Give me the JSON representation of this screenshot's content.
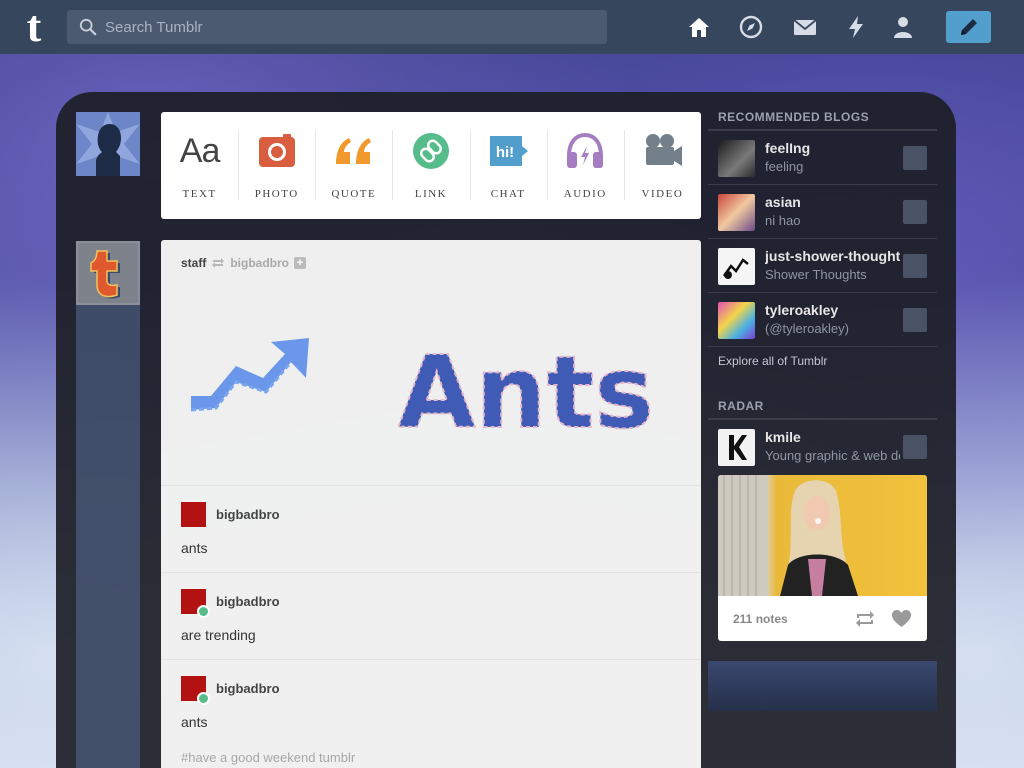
{
  "search": {
    "placeholder": "Search Tumblr"
  },
  "nav": {
    "icons": [
      "home-icon",
      "compass-icon",
      "mail-icon",
      "lightning-icon",
      "person-icon"
    ],
    "compose_icon": "pencil-icon",
    "accent": "#529ecc",
    "bar_color": "#36465d"
  },
  "post_types": [
    {
      "label": "TEXT",
      "icon": "text-icon",
      "color": "#444444"
    },
    {
      "label": "PHOTO",
      "icon": "camera-icon",
      "color": "#d95e40"
    },
    {
      "label": "QUOTE",
      "icon": "quote-icon",
      "color": "#f2992e"
    },
    {
      "label": "LINK",
      "icon": "link-icon",
      "color": "#56bc8a"
    },
    {
      "label": "CHAT",
      "icon": "chat-icon",
      "color": "#529ecc"
    },
    {
      "label": "AUDIO",
      "icon": "headphones-icon",
      "color": "#a77dc2"
    },
    {
      "label": "VIDEO",
      "icon": "video-camera-icon",
      "color": "#748089"
    }
  ],
  "post": {
    "author": "staff",
    "reblogged_from": "bigbadbro",
    "art_text": "Ants",
    "replies": [
      {
        "name": "bigbadbro",
        "text": "ants"
      },
      {
        "name": "bigbadbro",
        "text": "are trending"
      },
      {
        "name": "bigbadbro",
        "text": "ants"
      }
    ],
    "tags": "#have a good weekend tumblr"
  },
  "sidebar": {
    "recommended_title": "RECOMMENDED BLOGS",
    "blogs": [
      {
        "name": "feelIng",
        "subtitle": "feeling"
      },
      {
        "name": "asian",
        "subtitle": "ni hao"
      },
      {
        "name": "just-shower-thoughts",
        "subtitle": "Shower Thoughts"
      },
      {
        "name": "tyleroakley",
        "subtitle": "(@tyleroakley)"
      }
    ],
    "explore_label": "Explore all of Tumblr",
    "radar_title": "RADAR",
    "radar_blog": {
      "name": "kmile",
      "subtitle": "Young graphic & web designer"
    },
    "radar_notes": "211 notes"
  }
}
